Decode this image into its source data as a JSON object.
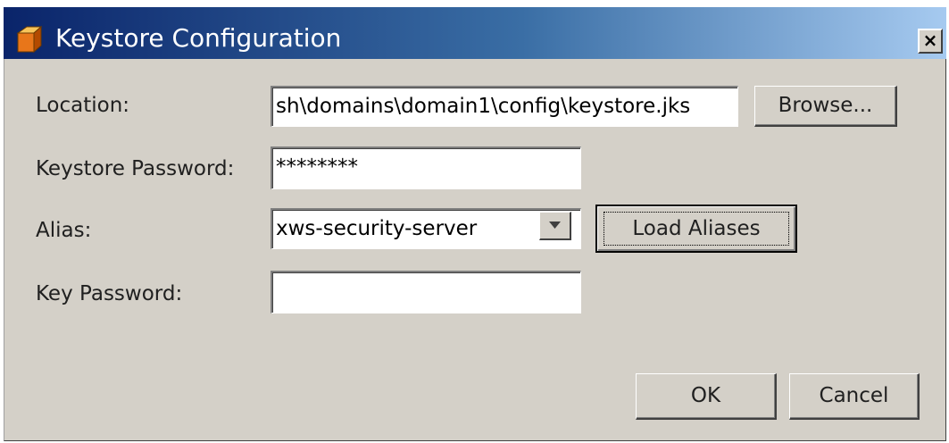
{
  "window": {
    "title": "Keystore Configuration",
    "close_label": "×"
  },
  "form": {
    "location": {
      "label": "Location:",
      "value": "sh\\domains\\domain1\\config\\keystore.jks",
      "browse_label": "Browse..."
    },
    "keystore_password": {
      "label": "Keystore Password:",
      "value": "********"
    },
    "alias": {
      "label": "Alias:",
      "selected": "xws-security-server",
      "load_label": "Load Aliases"
    },
    "key_password": {
      "label": "Key Password:",
      "value": ""
    }
  },
  "actions": {
    "ok_label": "OK",
    "cancel_label": "Cancel"
  },
  "colors": {
    "dialog_background": "#d4d0c8",
    "titlebar_start": "#0a246a",
    "titlebar_end": "#a6caf0"
  }
}
